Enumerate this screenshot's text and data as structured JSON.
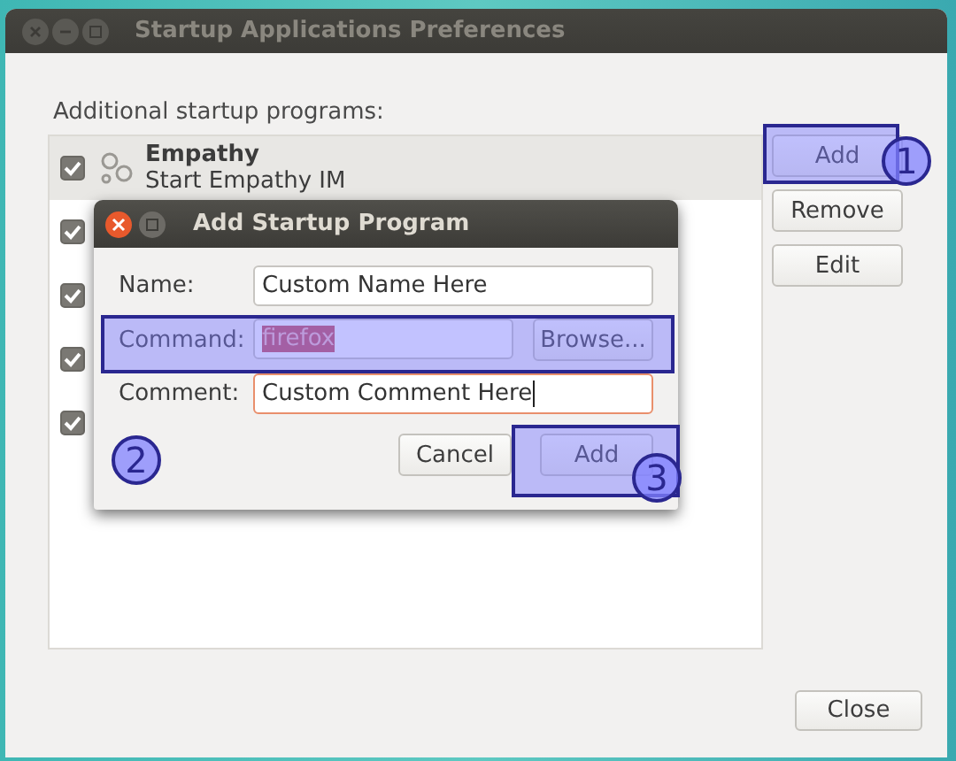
{
  "window": {
    "title": "Startup Applications Preferences"
  },
  "list_label": "Additional startup programs:",
  "programs": [
    {
      "name": "Empathy",
      "description": "Start Empathy IM",
      "checked": true,
      "selected": true
    },
    {
      "checked": true,
      "selected": false
    },
    {
      "checked": true,
      "selected": false
    },
    {
      "checked": true,
      "selected": false
    },
    {
      "checked": true,
      "selected": false
    }
  ],
  "side_buttons": [
    "Add",
    "Remove",
    "Edit"
  ],
  "close_button": "Close",
  "dialog": {
    "title": "Add Startup Program",
    "fields": [
      {
        "label": "Name:",
        "value": "Custom Name Here",
        "text_selected": false,
        "focused": false
      },
      {
        "label": "Command:",
        "value": "firefox",
        "text_selected": true,
        "focused": false,
        "button": "Browse..."
      },
      {
        "label": "Comment:",
        "value": "Custom Comment Here",
        "text_selected": false,
        "focused": true
      }
    ],
    "buttons": [
      "Cancel",
      "Add"
    ]
  },
  "annotations": [
    {
      "label": "1"
    },
    {
      "label": "2"
    },
    {
      "label": "3"
    }
  ]
}
